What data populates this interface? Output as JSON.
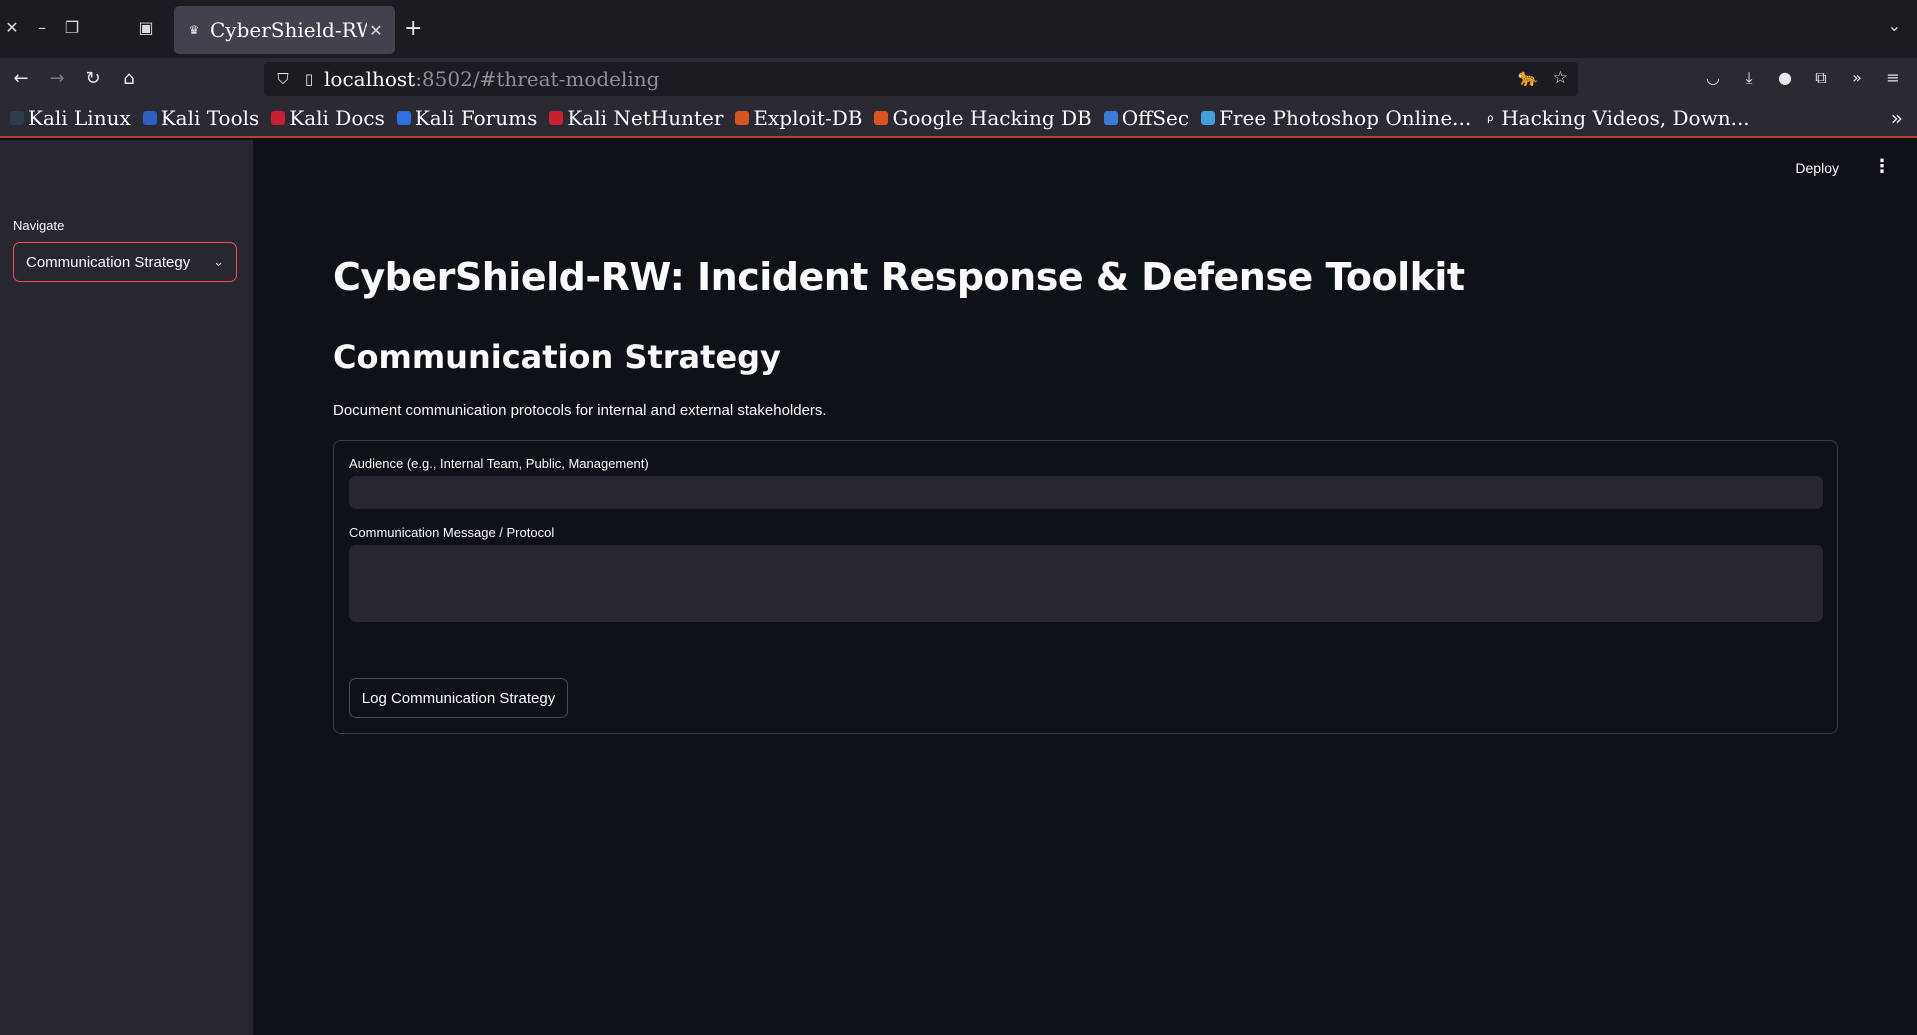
{
  "browser": {
    "tab_title": "CyberShield-RW",
    "url_host": "localhost",
    "url_rest": ":8502/#threat-modeling",
    "bookmarks": [
      {
        "label": "Kali Linux",
        "color": "#2d3c4e",
        "icon": "kali-dragon-icon"
      },
      {
        "label": "Kali Tools",
        "color": "#2f5fbf",
        "icon": "kali-tools-icon"
      },
      {
        "label": "Kali Docs",
        "color": "#c8202f",
        "icon": "kali-docs-icon"
      },
      {
        "label": "Kali Forums",
        "color": "#2f6fdf",
        "icon": "kali-forums-icon"
      },
      {
        "label": "Kali NetHunter",
        "color": "#c8202f",
        "icon": "nethunter-icon"
      },
      {
        "label": "Exploit-DB",
        "color": "#d9541e",
        "icon": "exploit-db-icon"
      },
      {
        "label": "Google Hacking DB",
        "color": "#d9541e",
        "icon": "ghdb-icon"
      },
      {
        "label": "OffSec",
        "color": "#3c7ad9",
        "icon": "offsec-icon"
      },
      {
        "label": "Free Photoshop Online...",
        "color": "#3fa0e0",
        "icon": "photoshop-icon"
      },
      {
        "label": "Hacking Videos, Down...",
        "color": "#2b2a33",
        "icon": "hacking-videos-icon"
      }
    ]
  },
  "sidebar": {
    "nav_label": "Navigate",
    "selected_page": "Communication Strategy"
  },
  "header": {
    "deploy_label": "Deploy"
  },
  "main": {
    "title": "CyberShield-RW: Incident Response & Defense Toolkit",
    "subtitle": "Communication Strategy",
    "description": "Document communication protocols for internal and external stakeholders.",
    "form": {
      "audience_label": "Audience (e.g., Internal Team, Public, Management)",
      "audience_value": "",
      "message_label": "Communication Message / Protocol",
      "message_value": "",
      "submit_label": "Log Communication Strategy"
    }
  },
  "colors": {
    "accent": "#ff4b4b",
    "background": "#0e1117",
    "sidebar": "#262730"
  }
}
